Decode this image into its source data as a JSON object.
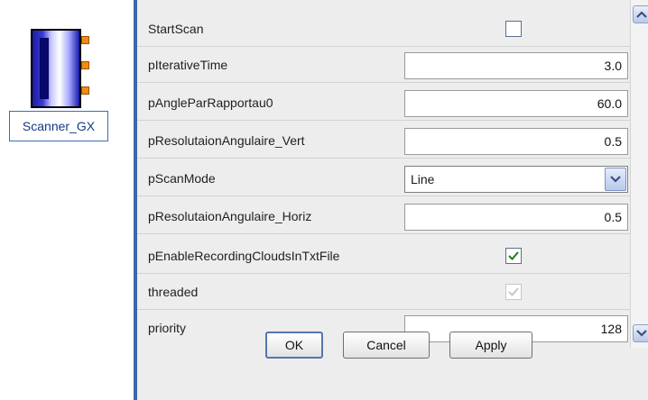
{
  "component": {
    "label": "Scanner_GX",
    "ports": 3
  },
  "properties": [
    {
      "label": "StartScan",
      "type": "checkbox",
      "checked": false,
      "enabled": true
    },
    {
      "label": "pIterativeTime",
      "type": "number",
      "value": "3.0"
    },
    {
      "label": "pAngleParRapportau0",
      "type": "number",
      "value": "60.0"
    },
    {
      "label": "pResolutaionAngulaire_Vert",
      "type": "number",
      "value": "0.5"
    },
    {
      "label": "pScanMode",
      "type": "select",
      "value": "Line"
    },
    {
      "label": "pResolutaionAngulaire_Horiz",
      "type": "number",
      "value": "0.5"
    },
    {
      "label": "pEnableRecordingCloudsInTxtFile",
      "type": "checkbox",
      "checked": true,
      "enabled": true
    },
    {
      "label": "threaded",
      "type": "checkbox",
      "checked": true,
      "enabled": false
    },
    {
      "label": "priority",
      "type": "number",
      "value": "128"
    }
  ],
  "buttons": {
    "ok": "OK",
    "cancel": "Cancel",
    "apply": "Apply"
  },
  "icons": {
    "check_mark": "check-icon",
    "scroll_up": "scroll-up-icon",
    "scroll_down": "scroll-down-icon",
    "dropdown": "chevron-down-icon"
  },
  "colors": {
    "panel_border": "#3c66ad",
    "port": "#ef8c12",
    "check_green": "#1f7a1f"
  }
}
